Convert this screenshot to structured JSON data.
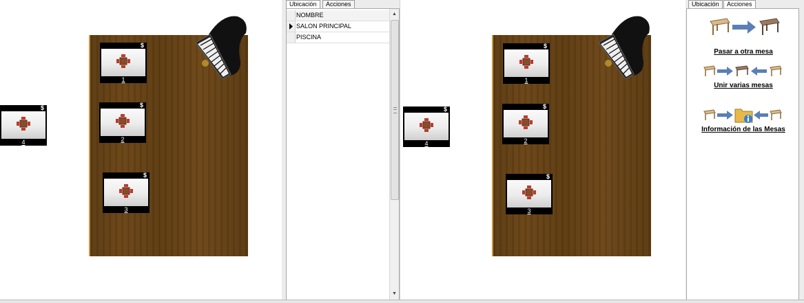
{
  "left_pane": {
    "tables": [
      {
        "number": "1",
        "badge": "$"
      },
      {
        "number": "2",
        "badge": "$"
      },
      {
        "number": "3",
        "badge": "$"
      },
      {
        "number": "4",
        "badge": "$"
      }
    ]
  },
  "middle_panel": {
    "tabs": [
      {
        "label": "Ubicación",
        "active": true
      },
      {
        "label": "Acciones",
        "active": false
      }
    ],
    "grid": {
      "header": "NOMBRE",
      "rows": [
        "SALON PRINCIPAL",
        "PISCINA"
      ],
      "selected_row": 0
    }
  },
  "right_pane": {
    "tables": [
      {
        "number": "1",
        "badge": "$"
      },
      {
        "number": "2",
        "badge": "$"
      },
      {
        "number": "3",
        "badge": "$"
      },
      {
        "number": "4",
        "badge": "$"
      }
    ]
  },
  "right_panel": {
    "tabs": [
      {
        "label": "Ubicación",
        "active": false
      },
      {
        "label": "Acciones",
        "active": true
      }
    ],
    "actions": [
      {
        "label": "Pasar a otra mesa",
        "icon": "move-table-icon"
      },
      {
        "label": "Unir varias mesas",
        "icon": "join-tables-icon"
      },
      {
        "label": "Información de las Mesas",
        "icon": "tables-info-icon"
      }
    ]
  },
  "colors": {
    "floor": "#5e3c11",
    "table_frame": "#000000",
    "arrow_blue": "#5b7fb5"
  }
}
